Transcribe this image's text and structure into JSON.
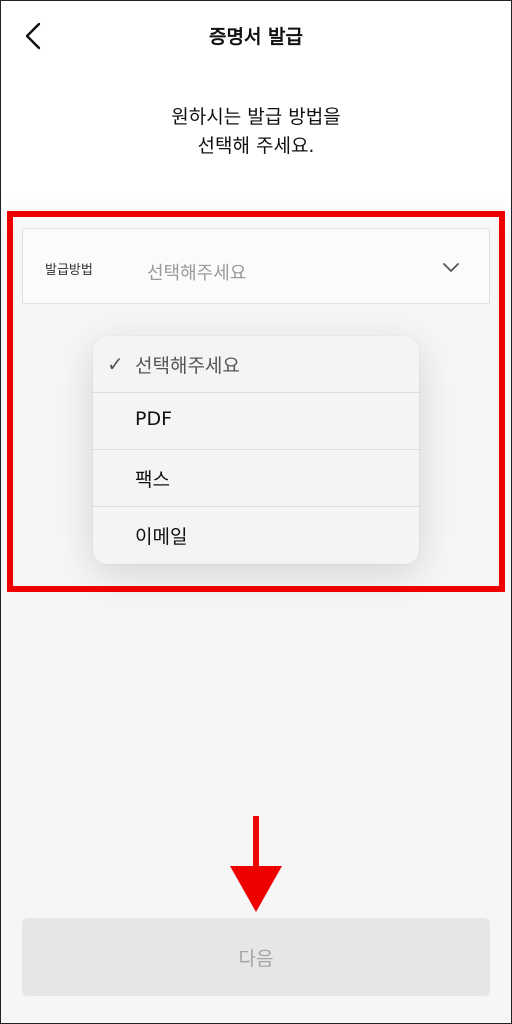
{
  "header": {
    "title": "증명서 발급",
    "back_icon": "chevron-left-icon"
  },
  "instruction": {
    "line1": "원하시는 발급 방법을",
    "line2": "선택해 주세요."
  },
  "field": {
    "label": "발급방법",
    "value": "선택해주세요",
    "chevron_icon": "chevron-down-icon"
  },
  "dropdown": {
    "options": [
      {
        "label": "선택해주세요",
        "selected": true
      },
      {
        "label": "PDF",
        "selected": false
      },
      {
        "label": "팩스",
        "selected": false
      },
      {
        "label": "이메일",
        "selected": false
      }
    ],
    "check_glyph": "✓"
  },
  "next_button": {
    "label": "다음"
  },
  "colors": {
    "annotation": "#ee0000",
    "placeholder": "#9a9a9a",
    "button_bg": "#e6e6e6",
    "button_text": "#a4a4a4"
  }
}
